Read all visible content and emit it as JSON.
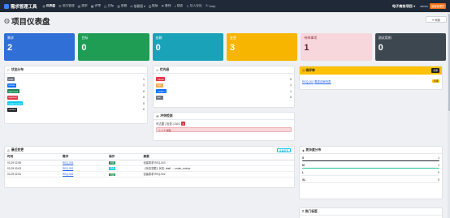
{
  "navbar": {
    "brand": "需求管理工具",
    "items": [
      {
        "icon": "◎",
        "label": "仪表盘",
        "active": true
      },
      {
        "icon": "☰",
        "label": "项目管理"
      },
      {
        "icon": "▤",
        "label": "需求"
      },
      {
        "icon": "▦",
        "label": "评审"
      },
      {
        "icon": "◫",
        "label": "目标"
      },
      {
        "icon": "▥",
        "label": "依赖"
      },
      {
        "icon": "⇄",
        "label": "依赖图 ▾"
      },
      {
        "icon": "⎙",
        "label": "链接"
      },
      {
        "icon": "⚑",
        "label": "基线"
      },
      {
        "icon": "⌕",
        "label": "搜索"
      },
      {
        "icon": "↧",
        "label": "导入导出"
      },
      {
        "icon": "Ⓐ",
        "label": "Help"
      }
    ],
    "project": "电子商务项目 ▾",
    "user": "admin",
    "role": "超级管理员"
  },
  "page": {
    "title": "项目仪表盘",
    "refresh": "⟳ 刷新"
  },
  "stats": [
    {
      "label": "需求",
      "value": "2",
      "color": "#2f6fd6"
    },
    {
      "label": "目标",
      "value": "0",
      "color": "#1f9d55"
    },
    {
      "label": "依赖",
      "value": "0",
      "color": "#19a2b8"
    },
    {
      "label": "变更",
      "value": "3",
      "color": "#f7b500"
    },
    {
      "label": "待审事项",
      "value": "1",
      "color": "#f7d7dc",
      "light": true
    },
    {
      "label": "测试用例",
      "value": "0",
      "color": "#3d4750"
    }
  ],
  "status_dist": {
    "title": "状态分布",
    "items": [
      {
        "label": "draft",
        "count": "1",
        "color": "#6c757d"
      },
      {
        "label": "review",
        "count": "1",
        "color": "#0d6efd"
      },
      {
        "label": "approved",
        "count": "0",
        "color": "#198754"
      },
      {
        "label": "rejected",
        "count": "0",
        "color": "#dc3545"
      },
      {
        "label": "implemented",
        "count": "0",
        "color": "#0dcaf0"
      },
      {
        "label": "verified",
        "count": "0",
        "color": "#212529"
      }
    ]
  },
  "priority_dist": {
    "title": "优先级",
    "items": [
      {
        "label": "critical",
        "count": "0",
        "color": "#dc3545"
      },
      {
        "label": "high",
        "count": "1",
        "color": "#f0ad4e"
      },
      {
        "label": "medium",
        "count": "1",
        "color": "#0d6efd"
      },
      {
        "label": "low",
        "count": "0",
        "color": "#6c757d"
      }
    ]
  },
  "pending": {
    "title": "待评审",
    "count": "待审",
    "items": [
      {
        "id": "REQ-002",
        "title": "需求评审列表",
        "tag": "待审"
      }
    ]
  },
  "conflict": {
    "title": "冲突检测",
    "line": "可达图 | 检查 | DAG",
    "count": "2",
    "alert": "⚠ 1 个冲突"
  },
  "recent": {
    "title": "最近变更",
    "view_all": "查看所有",
    "headers": [
      "时间",
      "需求",
      "操作",
      "摘要"
    ],
    "rows": [
      {
        "time": "03-29 02:55",
        "req": "REQ-003",
        "op": "创建",
        "op_color": "#198754",
        "summary": "创建需求 REQ-003"
      },
      {
        "time": "03-29 03:03",
        "req": "REQ-002",
        "op": "修改",
        "op_color": "#0dcaf0",
        "summary": "【状态变更】状态: draft → under_review"
      },
      {
        "time": "03-29 02:51",
        "req": "REQ-002",
        "op": "创建",
        "op_color": "#198754",
        "summary": "创建需求 REQ-002"
      }
    ]
  },
  "complexity": {
    "title": "复杂度分布",
    "items": [
      {
        "label": "S",
        "count": "1",
        "pct": 100,
        "color": "#212529"
      },
      {
        "label": "M",
        "count": "1",
        "pct": 100,
        "color": "#20c997"
      },
      {
        "label": "L",
        "count": "0",
        "pct": 0,
        "color": "#0d6efd"
      },
      {
        "label": "XL",
        "count": "0",
        "pct": 0,
        "color": "#dc3545"
      }
    ]
  },
  "more": {
    "title": "热门标签"
  }
}
